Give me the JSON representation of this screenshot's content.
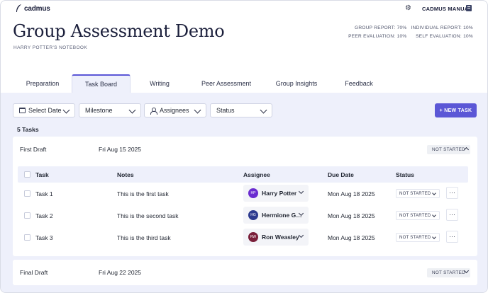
{
  "app": {
    "logo_text": "cadmus",
    "settings_icon": "gear-icon",
    "manual_label": "CADMUS MANUAL",
    "manual_icon": "book-icon"
  },
  "header": {
    "title": "Group Assessment Demo",
    "subtitle": "HARRY POTTER'S NOTEBOOK",
    "weights": [
      "GROUP REPORT: 70%",
      "INDIVIDUAL REPORT: 10%",
      "PEER EVALUATION: 10%",
      "SELF EVALUATION: 10%"
    ]
  },
  "tabs": [
    {
      "label": "Preparation",
      "active": false
    },
    {
      "label": "Task Board",
      "active": true
    },
    {
      "label": "Writing",
      "active": false
    },
    {
      "label": "Peer Assessment",
      "active": false
    },
    {
      "label": "Group Insights",
      "active": false
    },
    {
      "label": "Feedback",
      "active": false
    }
  ],
  "filters": {
    "date": "Select Date",
    "milestone": "Milestone",
    "assignees": "Assignees",
    "status": "Status"
  },
  "new_task_label": "+ NEW TASK",
  "task_count": "5 Tasks",
  "columns": [
    "Task",
    "Notes",
    "Assignee",
    "Due Date",
    "Status"
  ],
  "groups": [
    {
      "name": "First Draft",
      "date": "Fri Aug 15 2025",
      "status": "NOT STARTED",
      "expanded": true,
      "tasks": [
        {
          "task": "Task 1",
          "notes": "This is the first task",
          "initials": "HP",
          "assignee": "Harry Potter",
          "avatar_color": "#6a2bd0",
          "due": "Mon Aug 18 2025",
          "status": "NOT STARTED",
          "more": "···"
        },
        {
          "task": "Task 2",
          "notes": "This is the second task",
          "initials": "HG",
          "assignee": "Hermione Granger",
          "avatar_color": "#2c3a8f",
          "due": "Mon Aug 18 2025",
          "status": "NOT STARTED",
          "more": "···"
        },
        {
          "task": "Task 3",
          "notes": "This is the third task",
          "initials": "RW",
          "assignee": "Ron Weasley",
          "avatar_color": "#7a1f3a",
          "due": "Mon Aug 18 2025",
          "status": "NOT STARTED",
          "more": "···"
        }
      ]
    },
    {
      "name": "Final Draft",
      "date": "Fri Aug 22 2025",
      "status": "NOT STARTED",
      "expanded": false
    }
  ],
  "colors": {
    "accent": "#5b57d6",
    "board_bg": "#eef0fb"
  }
}
